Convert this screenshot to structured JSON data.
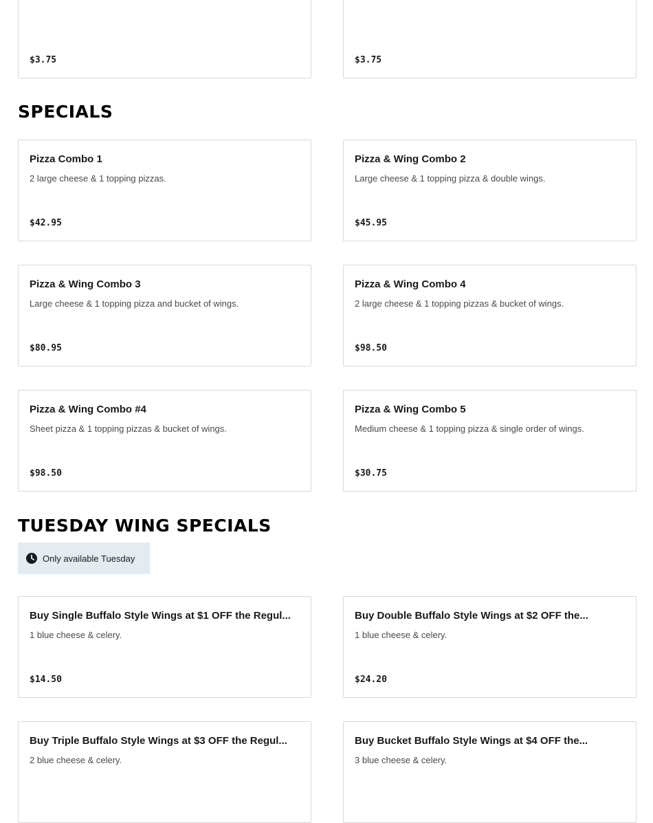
{
  "top_items": [
    {
      "name": "",
      "description": "",
      "price": "$3.75"
    },
    {
      "name": "",
      "description": "",
      "price": "$3.75"
    }
  ],
  "sections": {
    "specials": {
      "title": "SPECIALS",
      "items": [
        {
          "name": "Pizza Combo 1",
          "description": "2 large cheese & 1 topping pizzas.",
          "price": "$42.95"
        },
        {
          "name": "Pizza & Wing Combo 2",
          "description": "Large cheese & 1 topping pizza & double wings.",
          "price": "$45.95"
        },
        {
          "name": "Pizza & Wing Combo 3",
          "description": "Large cheese & 1 topping pizza and bucket of wings.",
          "price": "$80.95"
        },
        {
          "name": "Pizza & Wing Combo 4",
          "description": "2 large cheese & 1 topping pizzas & bucket of wings.",
          "price": "$98.50"
        },
        {
          "name": "Pizza & Wing Combo #4",
          "description": "Sheet pizza & 1 topping pizzas & bucket of wings.",
          "price": "$98.50"
        },
        {
          "name": "Pizza & Wing Combo 5",
          "description": "Medium cheese & 1 topping pizza & single order of wings.",
          "price": "$30.75"
        }
      ]
    },
    "tuesday": {
      "title": "TUESDAY WING SPECIALS",
      "availability": "Only available Tuesday",
      "items": [
        {
          "name": "Buy Single Buffalo Style Wings at $1 OFF the Regul...",
          "description": "1 blue cheese & celery.",
          "price": "$14.50"
        },
        {
          "name": "Buy Double Buffalo Style Wings at $2 OFF the...",
          "description": "1 blue cheese & celery.",
          "price": "$24.20"
        },
        {
          "name": "Buy Triple Buffalo Style Wings at $3 OFF the Regul...",
          "description": "2 blue cheese & celery.",
          "price": ""
        },
        {
          "name": "Buy Bucket Buffalo Style Wings at $4 OFF the...",
          "description": "3 blue cheese & celery.",
          "price": ""
        }
      ]
    }
  }
}
